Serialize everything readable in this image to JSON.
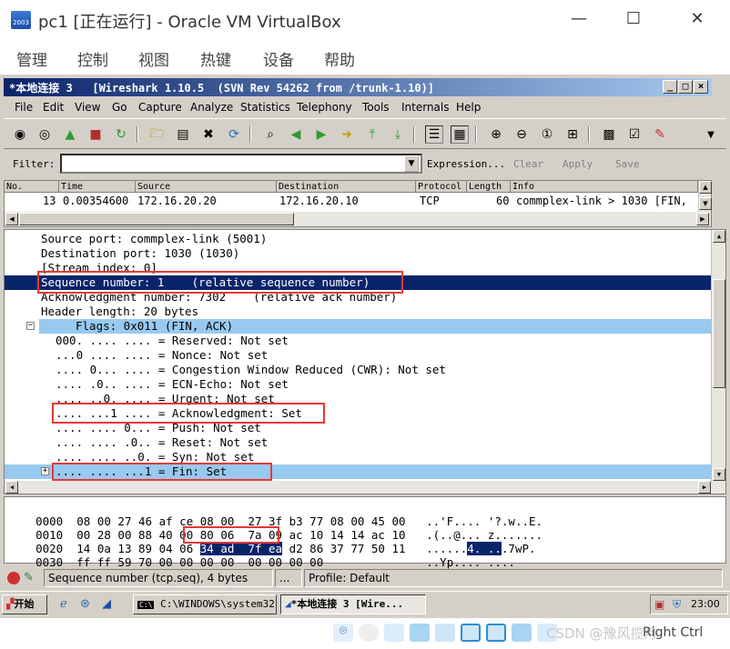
{
  "host": {
    "title": "pc1 [正在运行] - Oracle VM VirtualBox",
    "menus": [
      "管理",
      "控制",
      "视图",
      "热键",
      "设备",
      "帮助"
    ],
    "minimize": "—",
    "maximize": "☐",
    "close": "✕"
  },
  "wireshark": {
    "title": "*本地连接 3   [Wireshark 1.10.5  (SVN Rev 54262 from /trunk-1.10)]",
    "menus": [
      "File",
      "Edit",
      "View",
      "Go",
      "Capture",
      "Analyze",
      "Statistics",
      "Telephony",
      "Tools",
      "Internals",
      "Help"
    ],
    "filter": {
      "label": "Filter:",
      "value": "",
      "expression": "Expression...",
      "clear": "Clear",
      "apply": "Apply",
      "save": "Save"
    },
    "packet_list": {
      "columns": [
        "No.",
        "Time",
        "Source",
        "Destination",
        "Protocol",
        "Length",
        "Info"
      ],
      "row": {
        "no": "13",
        "time": "0.00354600",
        "source": "172.16.20.20",
        "destination": "172.16.20.10",
        "protocol": "TCP",
        "length": "60",
        "info": "commplex-link > 1030 [FIN,"
      }
    },
    "details": [
      "Source port: commplex-link (5001)",
      "Destination port: 1030 (1030)",
      "[Stream index: 0]",
      "Sequence number: 1    (relative sequence number)",
      "Acknowledgment number: 7302    (relative ack number)",
      "Header length: 20 bytes",
      "Flags: 0x011 (FIN, ACK)",
      "000. .... .... = Reserved: Not set",
      "...0 .... .... = Nonce: Not set",
      ".... 0... .... = Congestion Window Reduced (CWR): Not set",
      ".... .0.. .... = ECN-Echo: Not set",
      ".... ..0. .... = Urgent: Not set",
      ".... ...1 .... = Acknowledgment: Set",
      ".... .... 0... = Push: Not set",
      ".... .... .0.. = Reset: Not set",
      ".... .... ..0. = Syn: Not set",
      ".... .... ...1 = Fin: Set"
    ],
    "hex": [
      {
        "off": "0000",
        "a": "08 00 27 46 af ce 08 00",
        "b": "27 3f b3 77 08 00 45 00",
        "ascii": "..'F.... '?.w..E."
      },
      {
        "off": "0010",
        "a": "00 28 00 88 40 00 80 06",
        "b": "7a 09 ac 10 14 14 ac 10",
        "ascii": ".(..@... z......."
      },
      {
        "off": "0020",
        "a1": "14 0a 13 89 04 06",
        "sel": "34 ad  7f ea",
        "b": "d2 86 37 77 50 11",
        "ascii_pre": "......",
        "ascii_sel": "4. ..",
        "ascii_post": ".7wP."
      },
      {
        "off": "0030",
        "a": "ff ff 59 70 00 00 00 00",
        "b": "00 00 00 00",
        "ascii": "..Yp.... ...."
      }
    ],
    "status": {
      "field": "Sequence number (tcp.seq), 4 bytes",
      "middle": "...",
      "profile": "Profile: Default"
    }
  },
  "taskbar": {
    "start": "开始",
    "tasks": [
      "C:\\WINDOWS\\system32...",
      "*本地连接 3   [Wire..."
    ],
    "clock": "23:00"
  },
  "vbox_status": {
    "watermark": "CSDN @豫风揽月",
    "hostkey": "Right Ctrl"
  },
  "colors": {
    "selection": "#0a246a",
    "highlight_row": "#99c9ef",
    "annotation_box": "#e53935",
    "guest_chrome": "#d4d0c8"
  }
}
